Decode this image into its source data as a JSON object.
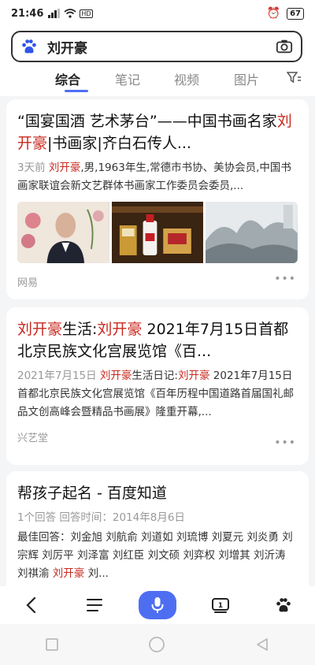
{
  "status": {
    "time": "21:46",
    "battery": "67"
  },
  "search": {
    "query": "刘开豪"
  },
  "tabs": [
    "综合",
    "笔记",
    "视频",
    "图片"
  ],
  "results": [
    {
      "title_1": "“国宴国酒 艺术茅台”——中国书画名家",
      "title_hl_1": "刘",
      "title_hl_2": "开豪",
      "title_2": "|书画家|齐白石传人...",
      "abs_date": "3天前",
      "abs_hl": "刘开豪",
      "abs_text": ",男,1963年生,常德市书协、美协会员,中国书画家联谊会新文艺群体书画家工作委员会委员,...",
      "source": "网易"
    },
    {
      "title_hl_1": "刘开豪",
      "title_1": "生活:",
      "title_hl_2": "刘开豪",
      "title_2": " 2021年7月15日首都北京民族文化宫展览馆《百...",
      "abs_date": "2021年7月15日",
      "abs_hl_1": "刘开豪",
      "abs_mid": "生活日记:",
      "abs_hl_2": "刘开豪",
      "abs_text": " 2021年7月15日首都北京民族文化宫展览馆《百年历程中国道路首届国礼邮品文创高峰会暨精品书画展》隆重开幕,...",
      "source": "兴艺堂"
    },
    {
      "title": "帮孩子起名 - 百度知道",
      "meta": "1个回答  回答时间：2014年8月6日",
      "abs_text": "最佳回答：刘金旭 刘航俞 刘道如 刘琉博 刘夏元 刘炎勇 刘宗辉 刘厉平 刘泽富 刘红臣 刘文硕 刘弈权 刘增其 刘沂涛 刘祺渝 ",
      "abs_hl": "刘开豪",
      "abs_tail": " 刘..."
    }
  ],
  "colors": {
    "accent": "#4e6ef2",
    "highlight": "#c8281e"
  }
}
